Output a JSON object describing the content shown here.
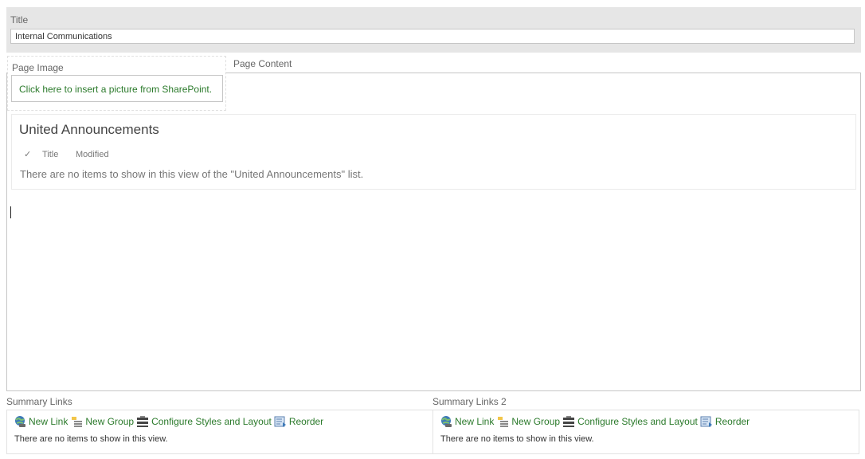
{
  "title_field": {
    "label": "Title",
    "value": "Internal Communications"
  },
  "page_image": {
    "label": "Page Image",
    "insert_link": "Click here to insert a picture from SharePoint."
  },
  "page_content": {
    "label": "Page Content",
    "webpart": {
      "title": "United Announcements",
      "checkmark": "✓",
      "columns": [
        "Title",
        "Modified"
      ],
      "empty_message": "There are no items to show in this view of the \"United Announcements\" list."
    }
  },
  "summary_links": [
    {
      "label": "Summary Links",
      "actions": {
        "new_link": "New Link",
        "new_group": "New Group",
        "configure": "Configure Styles and Layout",
        "reorder": "Reorder"
      },
      "empty_message": "There are no items to show in this view."
    },
    {
      "label": "Summary Links 2",
      "actions": {
        "new_link": "New Link",
        "new_group": "New Group",
        "configure": "Configure Styles and Layout",
        "reorder": "Reorder"
      },
      "empty_message": "There are no items to show in this view."
    }
  ],
  "colors": {
    "link_green": "#2b7a2b",
    "band_gray": "#e6e6e6",
    "border_gray": "#c6c6c6"
  },
  "icons": [
    "globe-link-icon",
    "new-group-icon",
    "configure-styles-icon",
    "reorder-icon"
  ]
}
